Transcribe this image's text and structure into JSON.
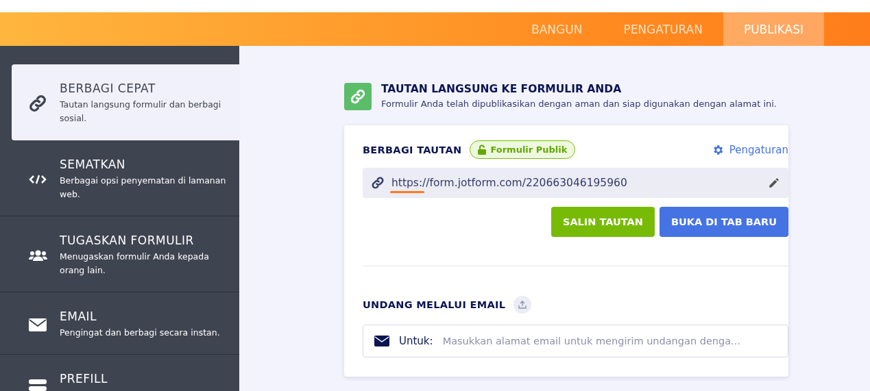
{
  "top_tabs": [
    {
      "label": "BANGUN",
      "selected": false
    },
    {
      "label": "PENGATURAN",
      "selected": false
    },
    {
      "label": "PUBLIKASI",
      "selected": true
    }
  ],
  "sidebar": {
    "items": [
      {
        "kind": "link",
        "title": "BERBAGI CEPAT",
        "description": "Tautan langsung formulir dan berbagi sosial.",
        "selected": true
      },
      {
        "kind": "code",
        "title": "SEMATKAN",
        "description": "Berbagai opsi penyematan di lamanan web.",
        "selected": false
      },
      {
        "kind": "users",
        "title": "TUGASKAN FORMULIR",
        "description": "Menugaskan formulir Anda kepada orang lain.",
        "selected": false
      },
      {
        "kind": "mail",
        "title": "EMAIL",
        "description": "Pengingat dan berbagi secara instan.",
        "selected": false
      },
      {
        "kind": "prefill",
        "title": "PREFILL",
        "selected": false
      }
    ]
  },
  "header": {
    "title": "TAUTAN LANGSUNG KE FORMULIR ANDA",
    "subtitle": "Formulir Anda telah dipublikasikan dengan aman dan siap digunakan dengan alamat ini."
  },
  "share": {
    "title": "BERBAGI TAUTAN",
    "badge": "Formulir Publik",
    "settings_link": "Pengaturan",
    "url": "https://form.jotform.com/220663046195960",
    "buttons": [
      {
        "label": "SALIN TAUTAN",
        "kind": "primary"
      },
      {
        "label": "BUKA DI TAB BARU",
        "kind": "secondary"
      }
    ]
  },
  "invite": {
    "title": "UNDANG MELALUI EMAIL",
    "to_label": "Untuk:",
    "placeholder": "Masukkan alamat email untuk mengirim undangan denga..."
  }
}
